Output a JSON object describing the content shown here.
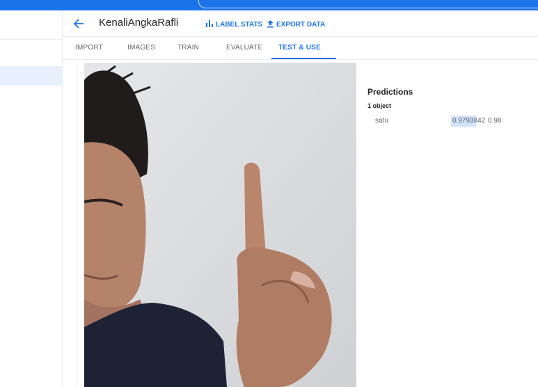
{
  "header": {
    "title": "KenaliAngkaRafli",
    "label_stats": "LABEL STATS",
    "export_data": "EXPORT DATA"
  },
  "tabs": [
    {
      "label": "IMPORT"
    },
    {
      "label": "IMAGES"
    },
    {
      "label": "TRAIN"
    },
    {
      "label": "EVALUATE"
    },
    {
      "label": "TEST & USE",
      "active": true
    }
  ],
  "predictions": {
    "title": "Predictions",
    "count": "1 object",
    "items": [
      {
        "label": "satu",
        "score": "0.9793842",
        "rounded": "0.98",
        "confidence": 0.9793842
      }
    ]
  },
  "colors": {
    "accent": "#1a73e8",
    "score_highlight": "#d2e3fc"
  },
  "icons": {
    "back": "arrow-left-icon",
    "label_stats": "bar-chart-icon",
    "export_data": "upload-icon"
  }
}
